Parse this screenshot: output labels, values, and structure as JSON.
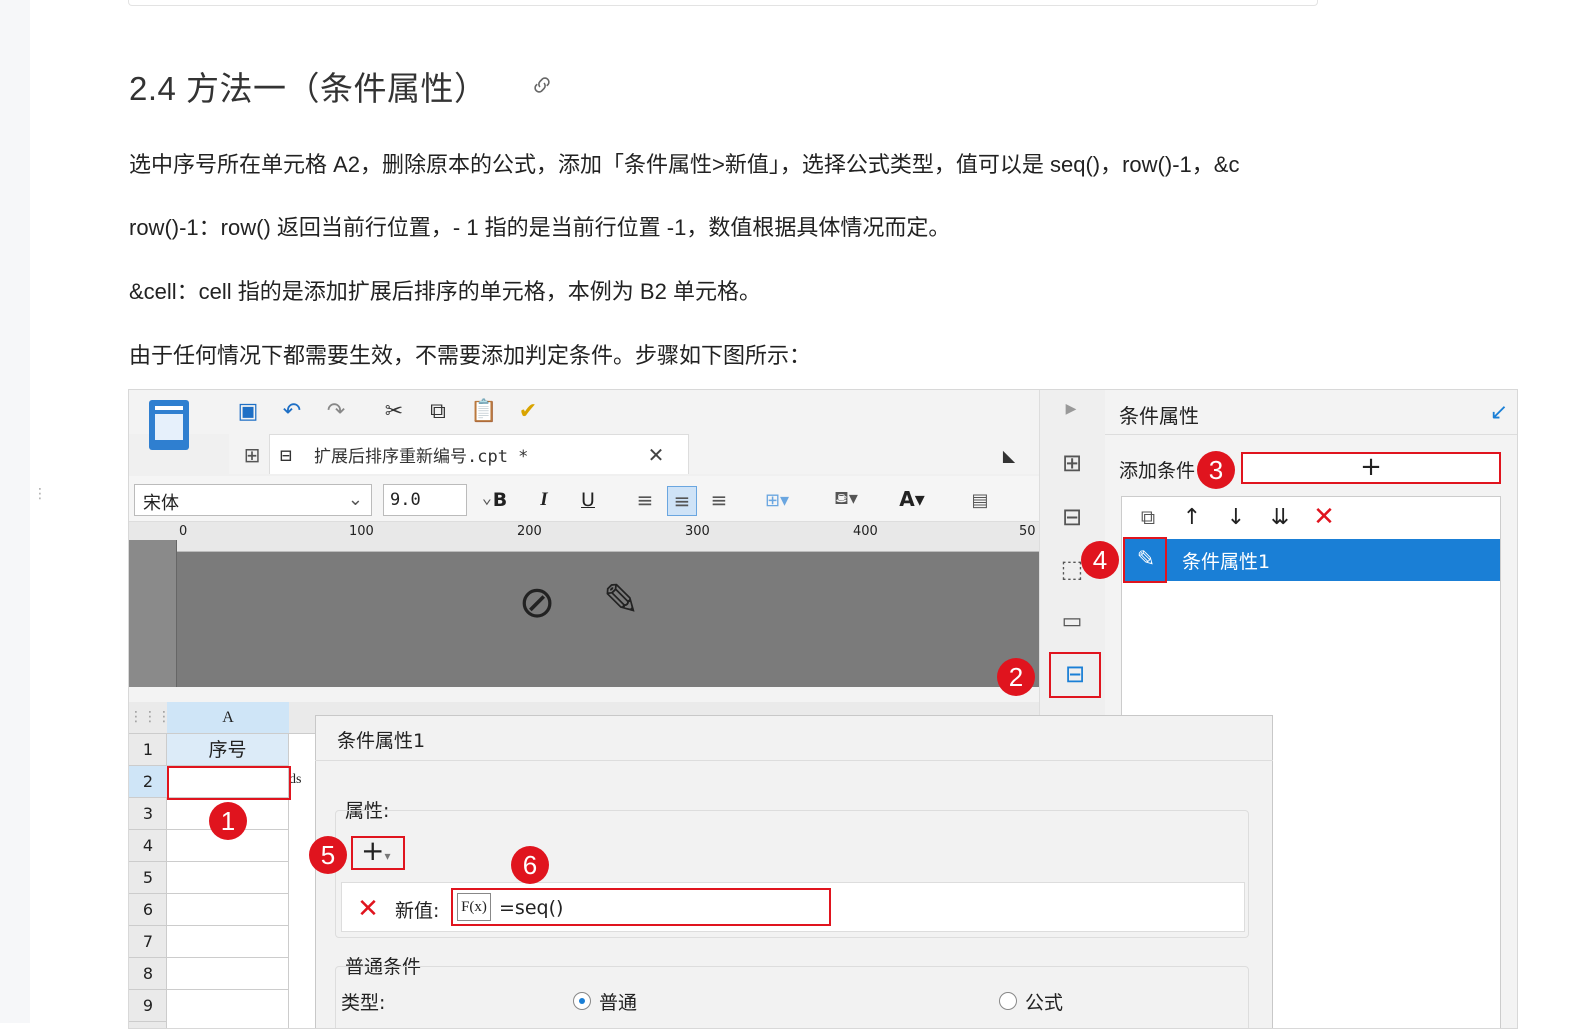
{
  "heading": "2.4 方法一（条件属性）",
  "paragraphs": [
    "选中序号所在单元格 A2，删除原本的公式，添加「条件属性>新值」，选择公式类型，值可以是 seq()，row()-1，&c",
    " row()-1：row() 返回当前行位置，- 1 指的是当前行位置 -1，数值根据具体情况而定。",
    "&cell：cell 指的是添加扩展后排序的单元格，本例为 B2 单元格。",
    "由于任何情况下都需要生效，不需要添加判定条件。步骤如下图所示："
  ],
  "screenshot": {
    "tab_title": "扩展后排序重新编号.cpt *",
    "font_name": "宋体",
    "font_size": "9.0",
    "ruler_marks": [
      "0",
      "100",
      "200",
      "300",
      "400",
      "50"
    ],
    "column_a": "A",
    "header_cell": "序号",
    "ds_text": "ds",
    "row_numbers": [
      "1",
      "2",
      "3",
      "4",
      "5",
      "6",
      "7",
      "8",
      "9"
    ],
    "panel_title": "条件属性",
    "add_condition_label": "添加条件",
    "condition_item": "条件属性1",
    "dialog_title": "条件属性1",
    "property_label": "属性:",
    "new_value_label": "新值:",
    "formula_value": "=seq()",
    "normal_condition_label": "普通条件",
    "type_label": "类型:",
    "radio_normal": "普通",
    "radio_formula": "公式",
    "fx_label": "F(x)",
    "badges": [
      "1",
      "2",
      "3",
      "4",
      "5",
      "6"
    ]
  }
}
